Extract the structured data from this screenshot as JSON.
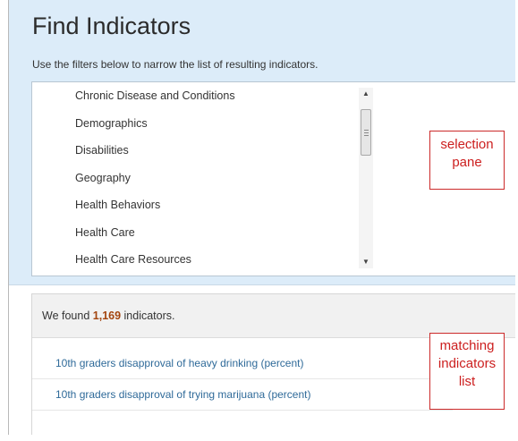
{
  "page": {
    "title": "Find Indicators",
    "instructions": "Use the filters below to narrow the list of resulting indicators."
  },
  "categories": [
    "Chronic Disease and Conditions",
    "Demographics",
    "Disabilities",
    "Geography",
    "Health Behaviors",
    "Health Care",
    "Health Care Resources"
  ],
  "results": {
    "prefix": "We found ",
    "count": "1,169",
    "suffix": " indicators.",
    "indicators": [
      "10th graders disapproval of heavy drinking (percent)",
      "10th graders disapproval of trying marijuana (percent)"
    ]
  },
  "annotations": {
    "selection_pane": [
      "selection",
      "pane"
    ],
    "matching_list": [
      "matching",
      "indicators",
      "list"
    ]
  },
  "colors": {
    "panel_background": "#dcecf9",
    "link": "#2f6a99",
    "count": "#a3450f",
    "callout": "#cc1f1f"
  }
}
